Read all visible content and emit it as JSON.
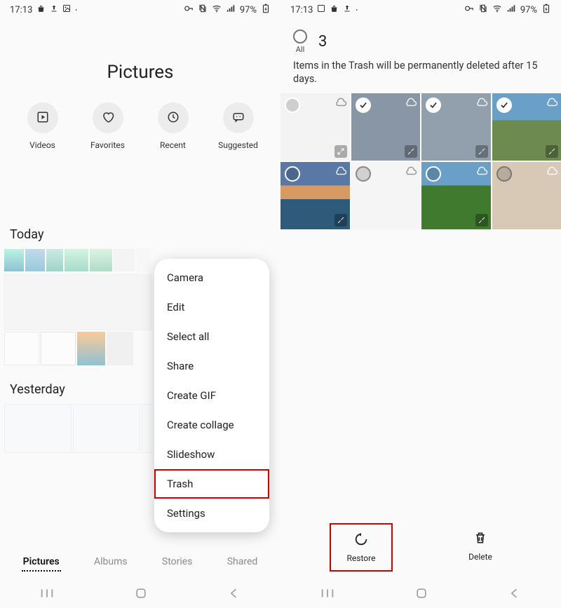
{
  "status": {
    "time": "17:13",
    "battery": "97%"
  },
  "left": {
    "title": "Pictures",
    "quick": {
      "videos": "Videos",
      "favorites": "Favorites",
      "recent": "Recent",
      "suggested": "Suggested"
    },
    "sections": {
      "today": "Today",
      "yesterday": "Yesterday"
    },
    "menu": {
      "camera": "Camera",
      "edit": "Edit",
      "select_all": "Select all",
      "share": "Share",
      "create_gif": "Create GIF",
      "create_collage": "Create collage",
      "slideshow": "Slideshow",
      "trash": "Trash",
      "settings": "Settings"
    },
    "tabs": {
      "pictures": "Pictures",
      "albums": "Albums",
      "stories": "Stories",
      "shared": "Shared"
    }
  },
  "right": {
    "select_all_label": "All",
    "count": "3",
    "message": "Items in the Trash will be permanently deleted after 15 days.",
    "actions": {
      "restore": "Restore",
      "delete": "Delete"
    }
  }
}
